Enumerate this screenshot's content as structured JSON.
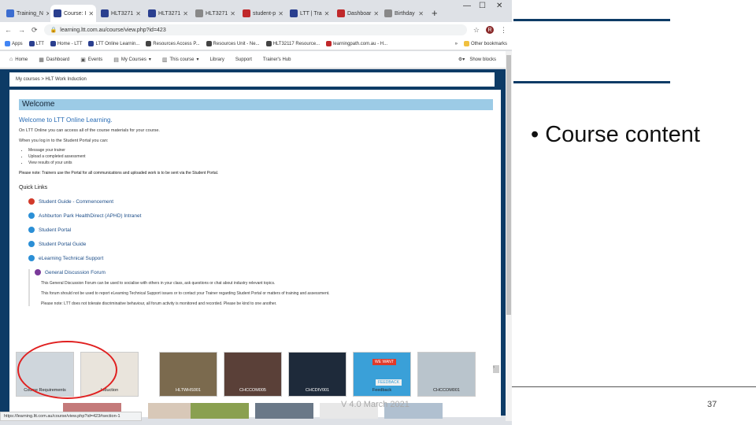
{
  "browser": {
    "tabs": [
      {
        "label": "Training_N",
        "color": "#3c6dd0"
      },
      {
        "label": "Course: I",
        "color": "#2a3f8f"
      },
      {
        "label": "HLT3271",
        "color": "#2a3f8f"
      },
      {
        "label": "HLT3271",
        "color": "#2a3f8f"
      },
      {
        "label": "HLT3271",
        "color": "#888888"
      },
      {
        "label": "student-p",
        "color": "#c0282a"
      },
      {
        "label": "LTT | Tra",
        "color": "#2a3f8f"
      },
      {
        "label": "Dashboar",
        "color": "#c0282a"
      },
      {
        "label": "Birthday",
        "color": "#888888"
      }
    ],
    "active_tab_index": 1,
    "url": "learning.ltt.com.au/course/view.php?id=423",
    "profile_letter": "R",
    "bookmarks": [
      "Apps",
      "LTT",
      "Home - LTT",
      "LTT Online Learnin...",
      "Resources Access P...",
      "Resources Unit - Ne...",
      "HLT32117 Resource...",
      "learningpath.com.au - H..."
    ],
    "other_bookmarks": "Other bookmarks",
    "nav_items": [
      "Home",
      "Dashboard",
      "Events",
      "My Courses",
      "This course",
      "Library",
      "Support",
      "Trainer's Hub"
    ],
    "show_blocks": "Show blocks",
    "breadcrumb": "My courses > HLT Work Induction",
    "status_url": "https://learning.ltt.com.au/course/view.php?id=423#section-1"
  },
  "course": {
    "welcome_bar": "Welcome",
    "welcome_title": "Welcome to LTT Online Learning.",
    "intro": "On LTT Online you can access all of the course materials for your course.",
    "login_text": "When you log in to the Student Portal you can:",
    "bullets": [
      "Message your trainer",
      "Upload a completed assessment",
      "View results of your units"
    ],
    "note": "Please note: Trainers use the Portal for all communications and uploaded work is to be sent via the Student Portal.",
    "quick_links_title": "Quick Links",
    "quick_links": [
      {
        "label": "Student Guide - Commencement",
        "color": "#d23a2a"
      },
      {
        "label": "Ashburton Park HealthDirect (APHD) Intranet",
        "color": "#2b8fd6"
      },
      {
        "label": "Student Portal",
        "color": "#2b8fd6"
      },
      {
        "label": "Student Portal Guide",
        "color": "#2b8fd6"
      },
      {
        "label": "eLearning Technical Support",
        "color": "#2b8fd6"
      }
    ],
    "forum_title": "General Discussion Forum",
    "forum_lines": [
      "This General Discussion Forum can be used to socialise with others in your class, ask questions or chat about industry relevant topics.",
      "This forum should not be used to report eLearning Technical Support issues or to contact your Trainer regarding Student Portal or matters of training and assessment.",
      "Please note: LTT does not tolerate discriminative behaviour, all forum activity is monitored and recorded. Please be kind to one another."
    ],
    "tiles": [
      {
        "label": "Course Requirements",
        "bg": "#cfd6dc",
        "dark": false
      },
      {
        "label": "Induction",
        "bg": "#e9e4dc",
        "dark": false
      },
      {
        "label": "HLTWHS001",
        "bg": "#7b6a4e",
        "dark": true
      },
      {
        "label": "CHCCOM005",
        "bg": "#5a4038",
        "dark": true
      },
      {
        "label": "CHCDIV001",
        "bg": "#1e2a3a",
        "dark": true
      },
      {
        "label": "Feedback",
        "bg": "#3aa0d8",
        "dark": false
      },
      {
        "label": "CHCCOM001",
        "bg": "#b9c4cc",
        "dark": false
      }
    ],
    "feedback_tag_top": "WE WANT",
    "feedback_tag_bottom": "FEEDBACK"
  },
  "slide": {
    "bullet": "• Course content",
    "date": "V 4.0 March 2021",
    "page_number": "37",
    "accent": "#0d3b66"
  }
}
